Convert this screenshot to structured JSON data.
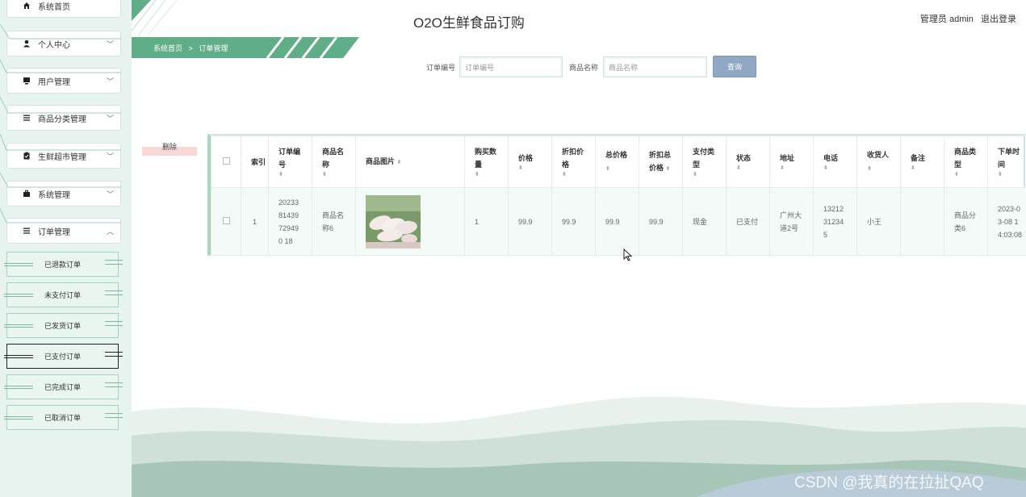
{
  "app": {
    "title": "O2O生鲜食品订购",
    "user_label": "管理员 admin",
    "logout_label": "退出登录"
  },
  "sidebar": {
    "items": [
      {
        "label": "系统首页",
        "icon": "home-icon"
      },
      {
        "label": "个人中心",
        "icon": "user-icon"
      },
      {
        "label": "用户管理",
        "icon": "monitor-icon"
      },
      {
        "label": "商品分类管理",
        "icon": "list-icon"
      },
      {
        "label": "生鲜超市管理",
        "icon": "clipboard-icon"
      },
      {
        "label": "系统管理",
        "icon": "briefcase-icon"
      },
      {
        "label": "订单管理",
        "icon": "list-icon"
      }
    ],
    "sub_items": [
      {
        "label": "已退款订单"
      },
      {
        "label": "未支付订单"
      },
      {
        "label": "已发货订单"
      },
      {
        "label": "已支付订单"
      },
      {
        "label": "已完成订单"
      },
      {
        "label": "已取消订单"
      }
    ]
  },
  "breadcrumb": {
    "home": "系统首页",
    "separator": ">",
    "current": "订单管理"
  },
  "search": {
    "order_no_label": "订单编号",
    "order_no_placeholder": "订单编号",
    "product_name_label": "商品名称",
    "product_name_placeholder": "商品名称",
    "button_label": "查询"
  },
  "actions": {
    "delete_label": "删除"
  },
  "table": {
    "headers": {
      "index": "索引",
      "order_no": "订单编号",
      "product_name": "商品名称",
      "product_image": "商品图片",
      "quantity": "购买数量",
      "price": "价格",
      "discount_price": "折扣价格",
      "total": "总价格",
      "discount_total": "折扣总价格",
      "payment_type": "支付类型",
      "status": "状态",
      "address": "地址",
      "phone": "电话",
      "receiver": "收货人",
      "remark": "备注",
      "category": "商品类型",
      "order_time": "下单时间"
    },
    "rows": [
      {
        "index": "1",
        "order_no": "2023381439729490 18",
        "product_name": "商品名称6",
        "quantity": "1",
        "price": "99.9",
        "discount_price": "99.9",
        "total": "99.9",
        "discount_total": "99.9",
        "payment_type": "现金",
        "status": "已支付",
        "address": "广州大道2号",
        "phone": "13212312345",
        "receiver": "小王",
        "remark": "",
        "category": "商品分类6",
        "order_time": "2023-03-08 14:03:08"
      }
    ]
  },
  "watermark": "CSDN @我真的在拉扯QAQ",
  "colors": {
    "accent": "#5fae88",
    "sidebar_bg": "#e6f3ee",
    "search_button": "#8fa9c4",
    "delete_highlight": "#f9d7d7"
  }
}
